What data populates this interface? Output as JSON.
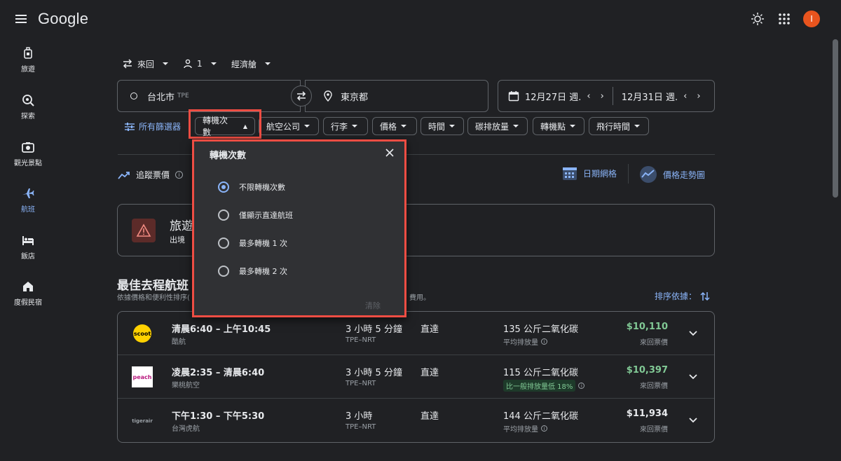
{
  "header": {
    "logo": "Google",
    "avatar_letter": "I",
    "avatar_color": "#e8541e"
  },
  "sidebar": {
    "items": [
      {
        "label": "旅遊",
        "icon": "luggage-icon"
      },
      {
        "label": "探索",
        "icon": "explore-icon"
      },
      {
        "label": "觀光景點",
        "icon": "camera-icon"
      },
      {
        "label": "航班",
        "icon": "airplane-icon",
        "active": true
      },
      {
        "label": "飯店",
        "icon": "bed-icon"
      },
      {
        "label": "度假民宿",
        "icon": "house-icon"
      }
    ]
  },
  "search": {
    "trip_type": "來回",
    "passengers": "1",
    "cabin": "經濟艙",
    "origin": "台北市",
    "origin_code": "TPE",
    "destination": "東京都",
    "depart_date": "12月27日 週.",
    "return_date": "12月31日 週."
  },
  "filters": {
    "all_filters": "所有篩選器",
    "chips": [
      "轉機次數",
      "航空公司",
      "行李",
      "價格",
      "時間",
      "碳排放量",
      "轉機點",
      "飛行時間"
    ]
  },
  "tools": {
    "track_prices": "追蹤票價",
    "date_grid": "日期網格",
    "price_graph": "價格走勢圖"
  },
  "advisory": {
    "title": "旅遊",
    "subtitle": "出境"
  },
  "results": {
    "title": "最佳去程航班",
    "subtitle": "依據價格和便利性排序(",
    "subtitle_tail": "費用。",
    "sort_by": "排序依據："
  },
  "flights": [
    {
      "time": "清晨6:40 – 上午10:45",
      "airline": "酷航",
      "logo": "scoot",
      "duration": "3 小時 5 分鐘",
      "route": "TPE–NRT",
      "stops": "直達",
      "co2": "135 公斤二氧化碳",
      "co2_note": "平均排放量",
      "co2_badge": "",
      "price": "$10,110",
      "price_color": "#81c995",
      "price_note": "來回票價"
    },
    {
      "time": "凌晨2:35 – 清晨6:40",
      "airline": "樂桃航空",
      "logo": "peach",
      "duration": "3 小時 5 分鐘",
      "route": "TPE–NRT",
      "stops": "直達",
      "co2": "115 公斤二氧化碳",
      "co2_note": "",
      "co2_badge": "比一般排放量低 18%",
      "price": "$10,397",
      "price_color": "#81c995",
      "price_note": "來回票價"
    },
    {
      "time": "下午1:30 – 下午5:30",
      "airline": "台灣虎航",
      "logo": "tigerair",
      "duration": "3 小時",
      "route": "TPE–NRT",
      "stops": "直達",
      "co2": "144 公斤二氧化碳",
      "co2_note": "平均排放量",
      "co2_badge": "",
      "price": "$11,934",
      "price_color": "#e8eaed",
      "price_note": "來回票價"
    }
  ],
  "stops_popup": {
    "title": "轉機次數",
    "options": [
      "不限轉機次數",
      "僅顯示直達航班",
      "最多轉機 1 次",
      "最多轉機 2 次"
    ],
    "selected_index": 0,
    "clear": "清除"
  },
  "colors": {
    "accent": "#8ab4f8",
    "highlight": "#ef4d43",
    "background": "#202124"
  }
}
